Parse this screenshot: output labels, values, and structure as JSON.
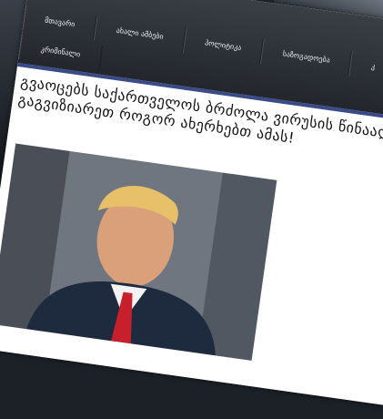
{
  "nav": {
    "row1": [
      "მთავარი",
      "ახალი ამბები",
      "პოლიტიკა",
      "საზოგადოება",
      "კ"
    ],
    "row2": [
      "კრიმინალი"
    ]
  },
  "article": {
    "headline": "გვაოცებს საქართველოს ბრძოლა ვირუსის წინააღმდეგ! ყოჩარ, გაგვიზიარეთ როგორ ახერხებთ ამას!"
  },
  "colors": {
    "navbar": "#2d3238",
    "nav_underline": "#3b4b8a",
    "article_bg": "#ffffff"
  }
}
